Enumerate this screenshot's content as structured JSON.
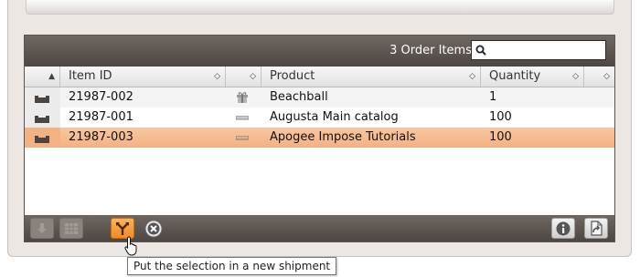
{
  "panel": {
    "order_count": "3 Order Items",
    "search": {
      "value": "",
      "placeholder": ""
    }
  },
  "columns": [
    {
      "label": ""
    },
    {
      "label": "Item ID"
    },
    {
      "label": ""
    },
    {
      "label": "Product"
    },
    {
      "label": "Quantity"
    },
    {
      "label": ""
    }
  ],
  "rows": [
    {
      "item_id": "21987-002",
      "product": "Beachball",
      "quantity": "1",
      "product_icon": "gift-icon",
      "selected": false
    },
    {
      "item_id": "21987-001",
      "product": "Augusta Main catalog",
      "quantity": "100",
      "product_icon": "document-icon",
      "selected": false
    },
    {
      "item_id": "21987-003",
      "product": "Apogee Impose Tutorials",
      "quantity": "100",
      "product_icon": "document-icon",
      "selected": true
    }
  ],
  "toolbar": {
    "buttons": [
      "move-down-icon",
      "grid-icon",
      "split-shipment-icon",
      "remove-icon",
      "info-icon",
      "export-document-icon"
    ]
  },
  "tooltip": {
    "text": "Put the selection in a new shipment"
  },
  "colors": {
    "accent": "#f08c1e",
    "selection": "#f4b184",
    "bar": "#5b534e"
  }
}
